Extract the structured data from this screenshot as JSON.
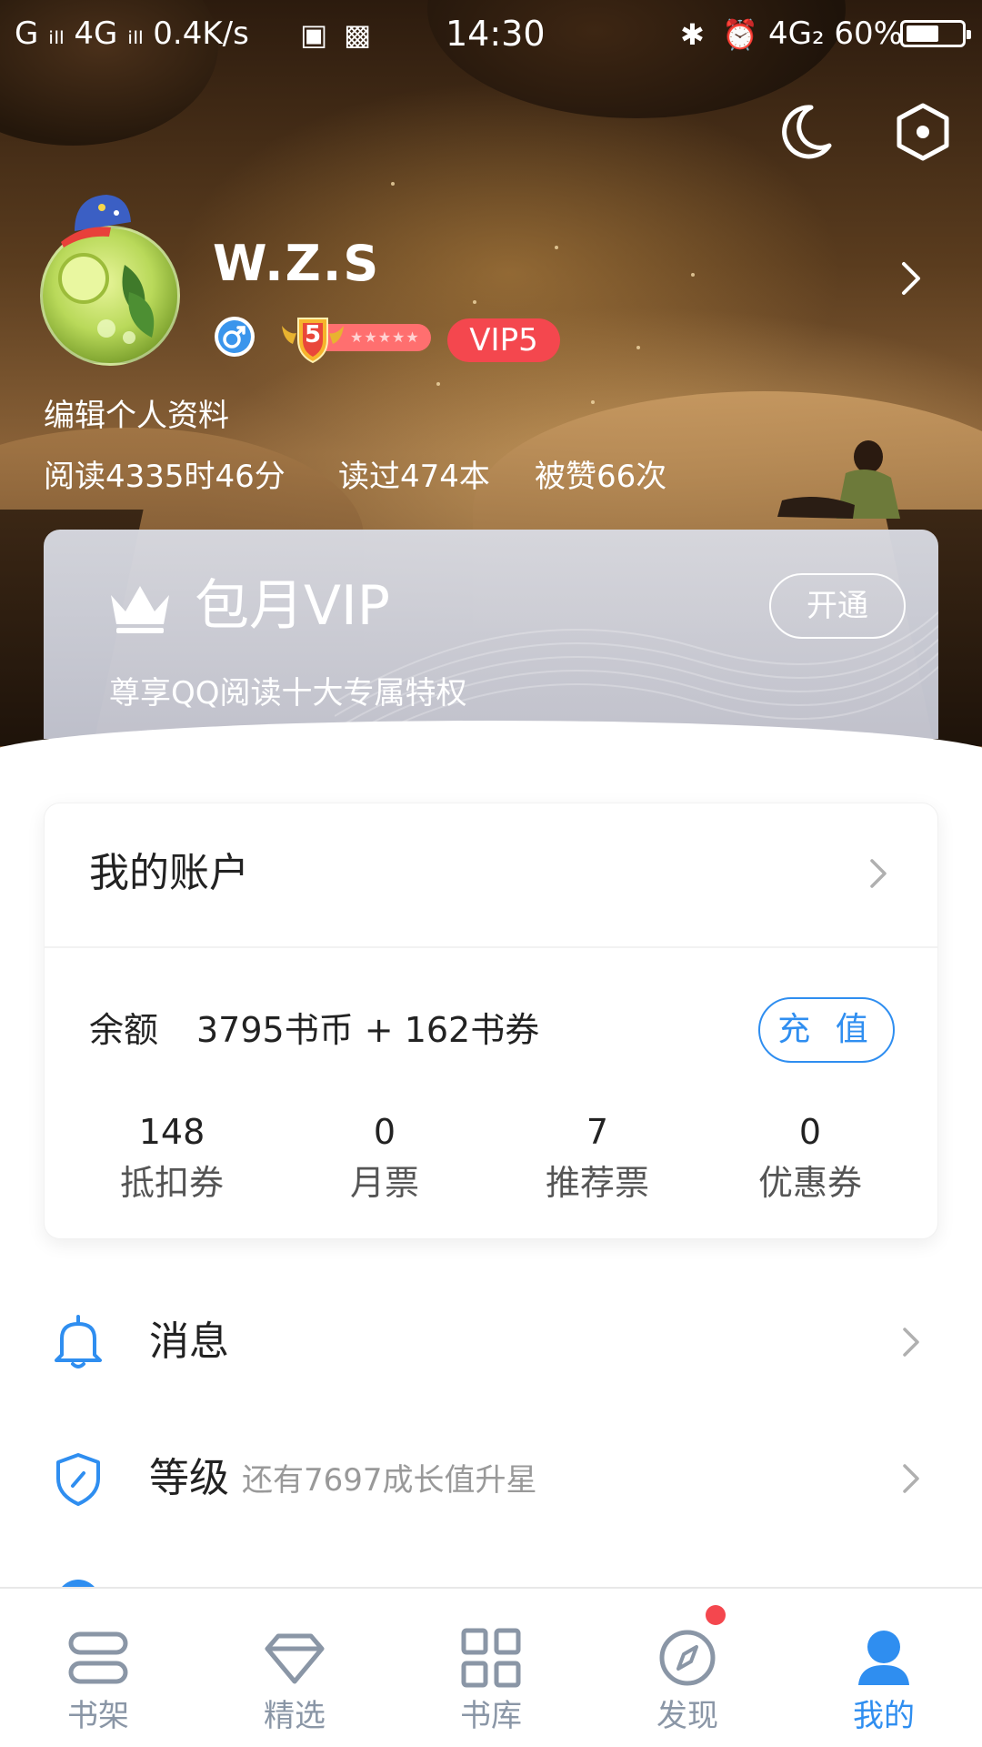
{
  "status_bar": {
    "left": "G ᵢₗₗ 4G ᵢₗₗ 0.4K/s",
    "time": "14:30",
    "network": "4G₂",
    "battery": "60%",
    "battery_level": 0.6
  },
  "header": {
    "username": "W.Z.S",
    "level": "5",
    "level_stars": "★★★★★",
    "vip_badge": "VIP5",
    "edit_profile": "编辑个人资料",
    "stats": {
      "read_time": "阅读4335时46分",
      "books_read": "读过474本",
      "likes": "被赞66次"
    }
  },
  "vip_card": {
    "title": "包月VIP",
    "subtitle": "尊享QQ阅读十大专属特权",
    "button": "开通"
  },
  "account": {
    "title": "我的账户",
    "balance_label": "余额",
    "balance_value": "3795书币 + 162书券",
    "recharge": "充 值",
    "stats": [
      {
        "value": "148",
        "label": "抵扣券"
      },
      {
        "value": "0",
        "label": "月票"
      },
      {
        "value": "7",
        "label": "推荐票"
      },
      {
        "value": "0",
        "label": "优惠券"
      }
    ]
  },
  "list": {
    "messages": {
      "label": "消息",
      "icon": "bell-icon"
    },
    "level": {
      "label": "等级",
      "hint": "还有7697成长值升星",
      "icon": "shield-icon"
    }
  },
  "bottom_nav": [
    {
      "label": "书架",
      "icon": "bookshelf-icon"
    },
    {
      "label": "精选",
      "icon": "diamond-icon"
    },
    {
      "label": "书库",
      "icon": "grid-icon"
    },
    {
      "label": "发现",
      "icon": "compass-icon",
      "badge": true
    },
    {
      "label": "我的",
      "icon": "profile-icon",
      "active": true
    }
  ],
  "colors": {
    "accent": "#2f8ef0",
    "vip_red": "#f4474e"
  }
}
